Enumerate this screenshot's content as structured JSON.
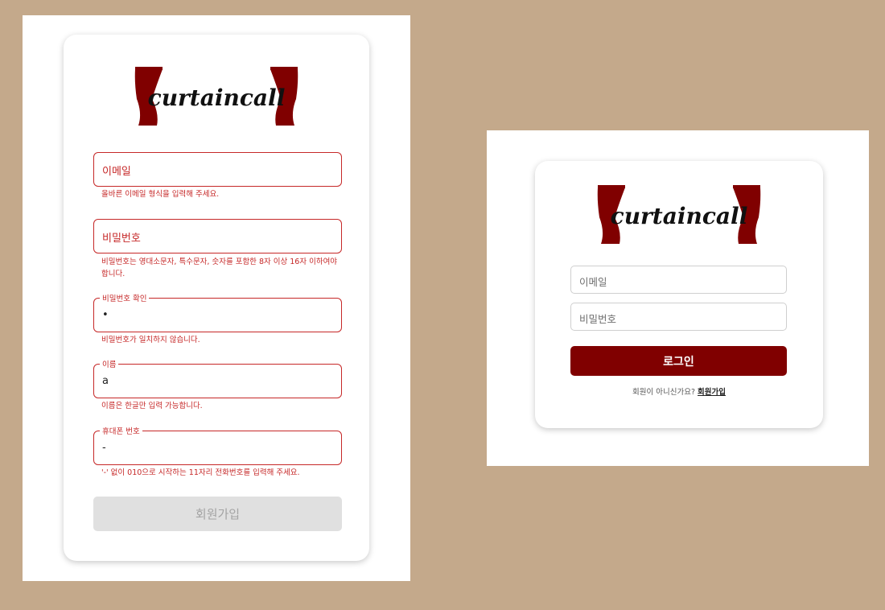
{
  "brand": {
    "logo_text": "curtaincall",
    "curtain_color": "#800000"
  },
  "signup": {
    "email": {
      "label": "이메일",
      "error": "올바른 이메일 형식을 입력해 주세요."
    },
    "password": {
      "label": "비밀번호",
      "error": "비밀번호는 영대소문자, 특수문자, 숫자를 포함한 8자 이상 16자 이하여야 합니다."
    },
    "password_confirm": {
      "label": "비밀번호 확인",
      "value": "•",
      "error": "비밀번호가 일치하지 않습니다."
    },
    "name": {
      "label": "이름",
      "value": "a",
      "error": "이름은 한글만 입력 가능합니다."
    },
    "phone": {
      "label": "휴대폰 번호",
      "value": "-",
      "error": "'-' 없이 010으로 시작하는 11자리 전화번호를 입력해 주세요."
    },
    "submit_label": "회원가입",
    "error_color": "#c62828"
  },
  "login": {
    "email_placeholder": "이메일",
    "password_placeholder": "비밀번호",
    "submit_label": "로그인",
    "footer_text": "회원이 아니신가요?",
    "signup_link": "회원가입",
    "button_color": "#800000"
  },
  "icons": [
    "curtain-left-icon",
    "curtain-right-icon"
  ]
}
